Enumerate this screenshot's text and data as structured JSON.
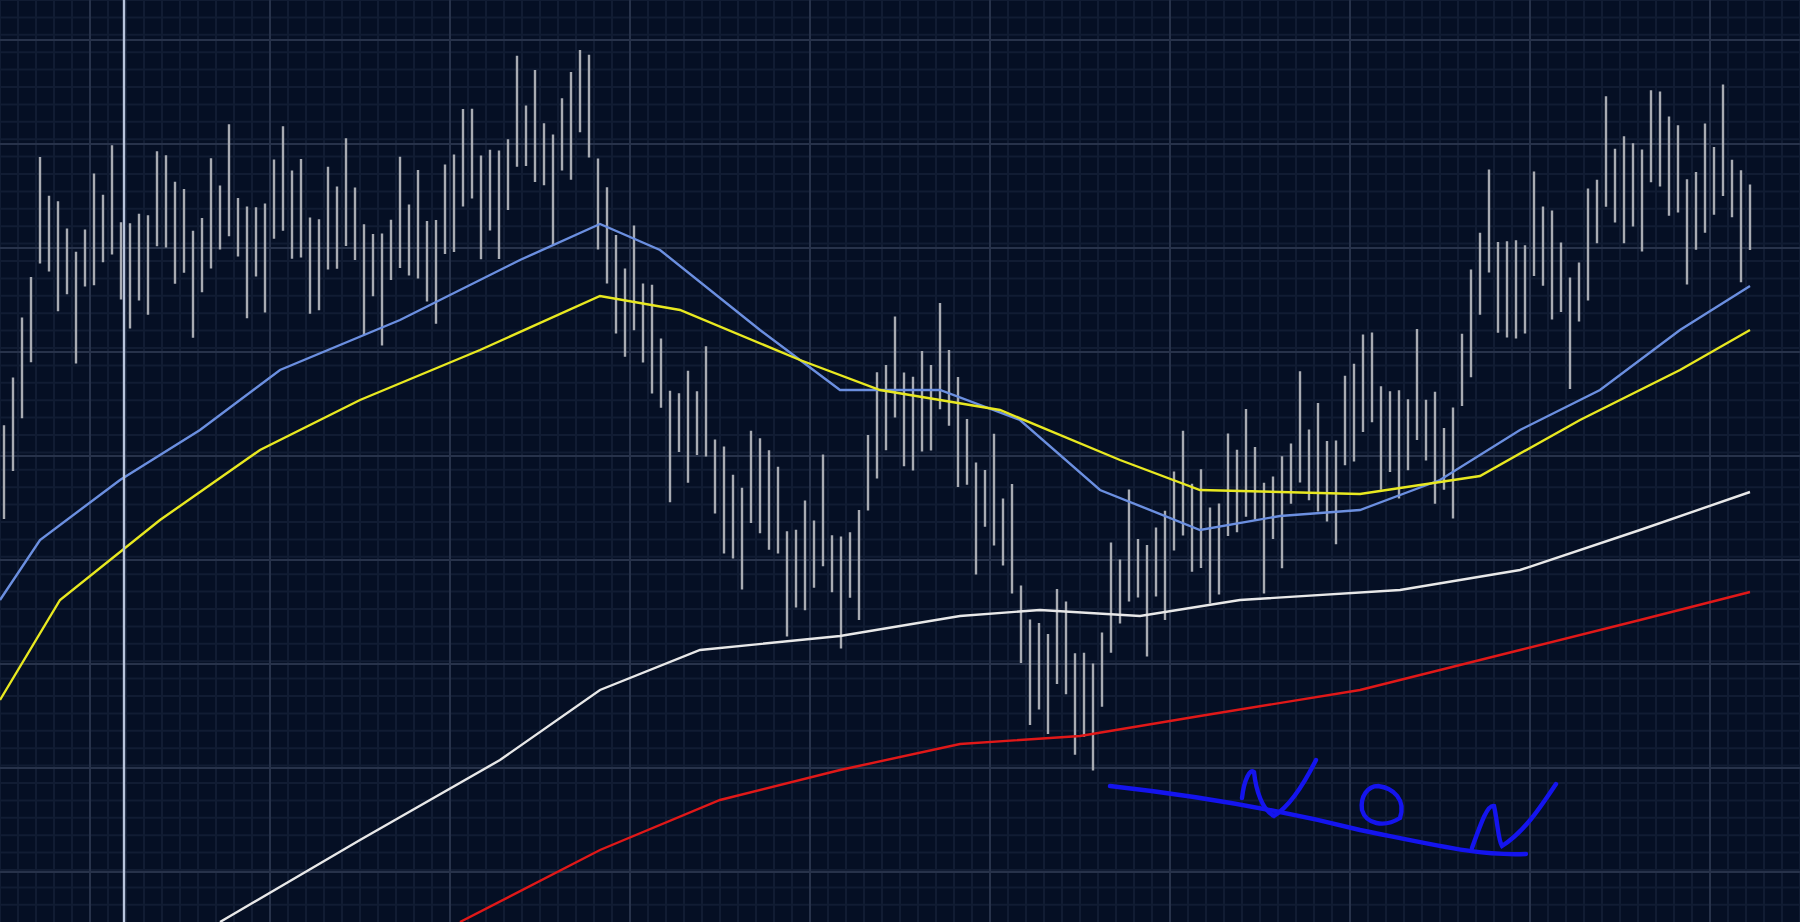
{
  "chart": {
    "moving_averages": [
      {
        "color": "#6b8fe0"
      },
      {
        "color": "#e8e820"
      },
      {
        "color": "#e8e8e8"
      },
      {
        "color": "#e01818"
      }
    ]
  }
}
